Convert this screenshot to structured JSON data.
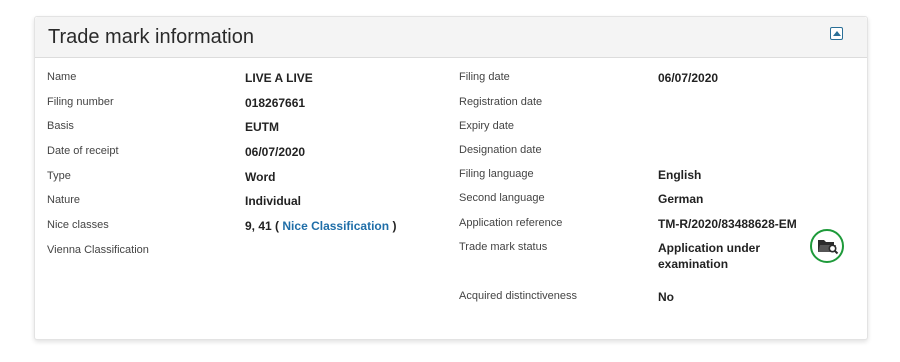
{
  "panel": {
    "title": "Trade mark information"
  },
  "left": {
    "name": {
      "label": "Name",
      "value": "LIVE A LIVE"
    },
    "filing_number": {
      "label": "Filing number",
      "value": "018267661"
    },
    "basis": {
      "label": "Basis",
      "value": "EUTM"
    },
    "date_of_receipt": {
      "label": "Date of receipt",
      "value": "06/07/2020"
    },
    "type": {
      "label": "Type",
      "value": "Word"
    },
    "nature": {
      "label": "Nature",
      "value": "Individual"
    },
    "nice_classes": {
      "label": "Nice classes",
      "value": "9, 41",
      "paren_open": "(",
      "link_text": "Nice Classification",
      "paren_close": ")"
    },
    "vienna": {
      "label": "Vienna Classification",
      "value": ""
    }
  },
  "right": {
    "filing_date": {
      "label": "Filing date",
      "value": "06/07/2020"
    },
    "registration_date": {
      "label": "Registration date",
      "value": ""
    },
    "expiry_date": {
      "label": "Expiry date",
      "value": ""
    },
    "designation_date": {
      "label": "Designation date",
      "value": ""
    },
    "filing_language": {
      "label": "Filing language",
      "value": "English"
    },
    "second_language": {
      "label": "Second language",
      "value": "German"
    },
    "application_reference": {
      "label": "Application reference",
      "value": "TM-R/2020/83488628-EM"
    },
    "trade_mark_status": {
      "label": "Trade mark status",
      "value_line1": "Application under",
      "value_line2": "examination"
    },
    "acquired_distinctiveness": {
      "label": "Acquired distinctiveness",
      "value": "No"
    }
  },
  "icons": {
    "collapse": "collapse-up-icon",
    "status": "folder-search-icon",
    "status_ring_color": "#1e9a3a"
  },
  "colors": {
    "link": "#1f6ea8",
    "header_bg": "#f4f4f4"
  }
}
